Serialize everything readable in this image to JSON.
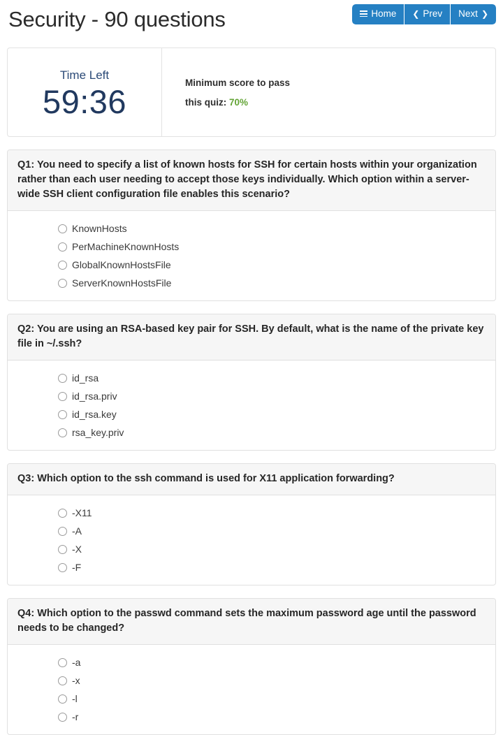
{
  "header": {
    "title": "Security - 90 questions",
    "buttons": [
      {
        "label": "Home",
        "icon": "hamburger-icon"
      },
      {
        "label": "Prev",
        "icon": "chevron-left-icon"
      },
      {
        "label": "Next",
        "icon": "chevron-right-icon"
      }
    ]
  },
  "info": {
    "time_label": "Time Left",
    "time_value": "59:36",
    "score_line1": "Minimum score to pass",
    "score_line2_prefix": "this quiz:",
    "score_percent": "70%"
  },
  "colors": {
    "primary": "#2580c3",
    "timer_text": "#21395f",
    "pass_score": "#63a436",
    "panel_head_bg": "#f6f6f6",
    "panel_border": "#e0e0e0"
  },
  "questions": [
    {
      "text": "Q1: You need to specify a list of known hosts for SSH for certain hosts within your organization rather than each user needing to accept those keys individually. Which option within a server-wide SSH client configuration file enables this scenario?",
      "options": [
        "KnownHosts",
        "PerMachineKnownHosts",
        "GlobalKnownHostsFile",
        "ServerKnownHostsFile"
      ]
    },
    {
      "text": "Q2: You are using an RSA-based key pair for SSH. By default, what is the name of the private key file in ~/.ssh?",
      "options": [
        "id_rsa",
        "id_rsa.priv",
        "id_rsa.key",
        "rsa_key.priv"
      ]
    },
    {
      "text": "Q3: Which option to the ssh command is used for X11 application forwarding?",
      "options": [
        "-X11",
        "-A",
        "-X",
        "-F"
      ]
    },
    {
      "text": "Q4: Which option to the passwd command sets the maximum password age until the password needs to be changed?",
      "options": [
        "-a",
        "-x",
        "-l",
        "-r"
      ]
    }
  ]
}
